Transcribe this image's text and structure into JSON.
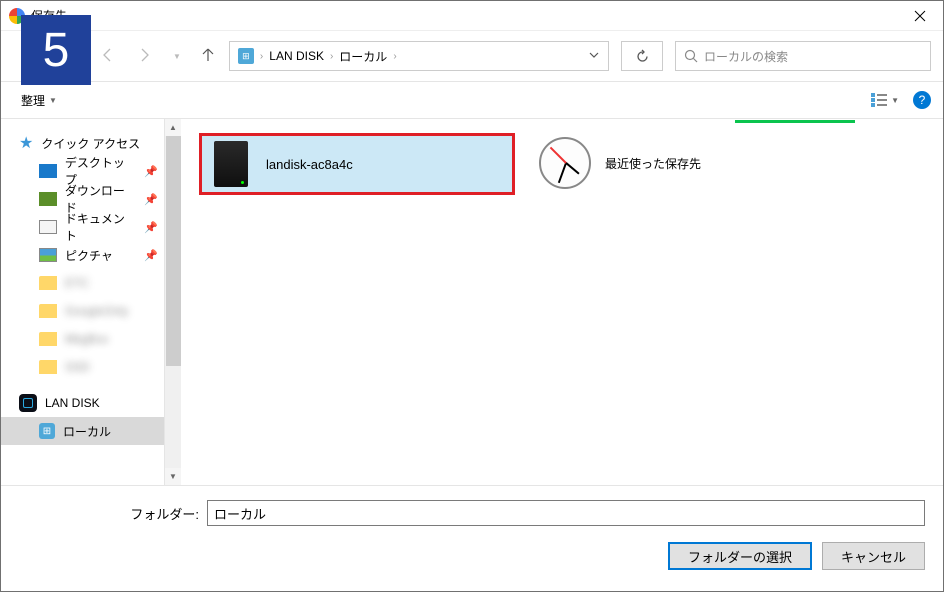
{
  "window": {
    "title": "保存先"
  },
  "badge": {
    "number": "5"
  },
  "nav": {
    "breadcrumb": {
      "root": "LAN DISK",
      "current": "ローカル"
    },
    "search_placeholder": "ローカルの検索"
  },
  "toolbar": {
    "organize": "整理"
  },
  "sidebar": {
    "quick_access": "クイック アクセス",
    "items": [
      {
        "label": "デスクトップ",
        "pinned": true
      },
      {
        "label": "ダウンロード",
        "pinned": true
      },
      {
        "label": "ドキュメント",
        "pinned": true
      },
      {
        "label": "ピクチャ",
        "pinned": true
      },
      {
        "label": "ETC",
        "pinned": false,
        "blurred": true
      },
      {
        "label": "GoogleOnly",
        "pinned": false,
        "blurred": true
      },
      {
        "label": "MkgBox",
        "pinned": false,
        "blurred": true
      },
      {
        "label": "SSD",
        "pinned": false,
        "blurred": true
      }
    ],
    "landisk": "LAN DISK",
    "local": "ローカル"
  },
  "content": {
    "items": [
      {
        "label": "landisk-ac8a4c"
      },
      {
        "label": "最近使った保存先"
      }
    ]
  },
  "footer": {
    "folder_label": "フォルダー:",
    "folder_value": "ローカル",
    "select_button": "フォルダーの選択",
    "cancel_button": "キャンセル"
  }
}
